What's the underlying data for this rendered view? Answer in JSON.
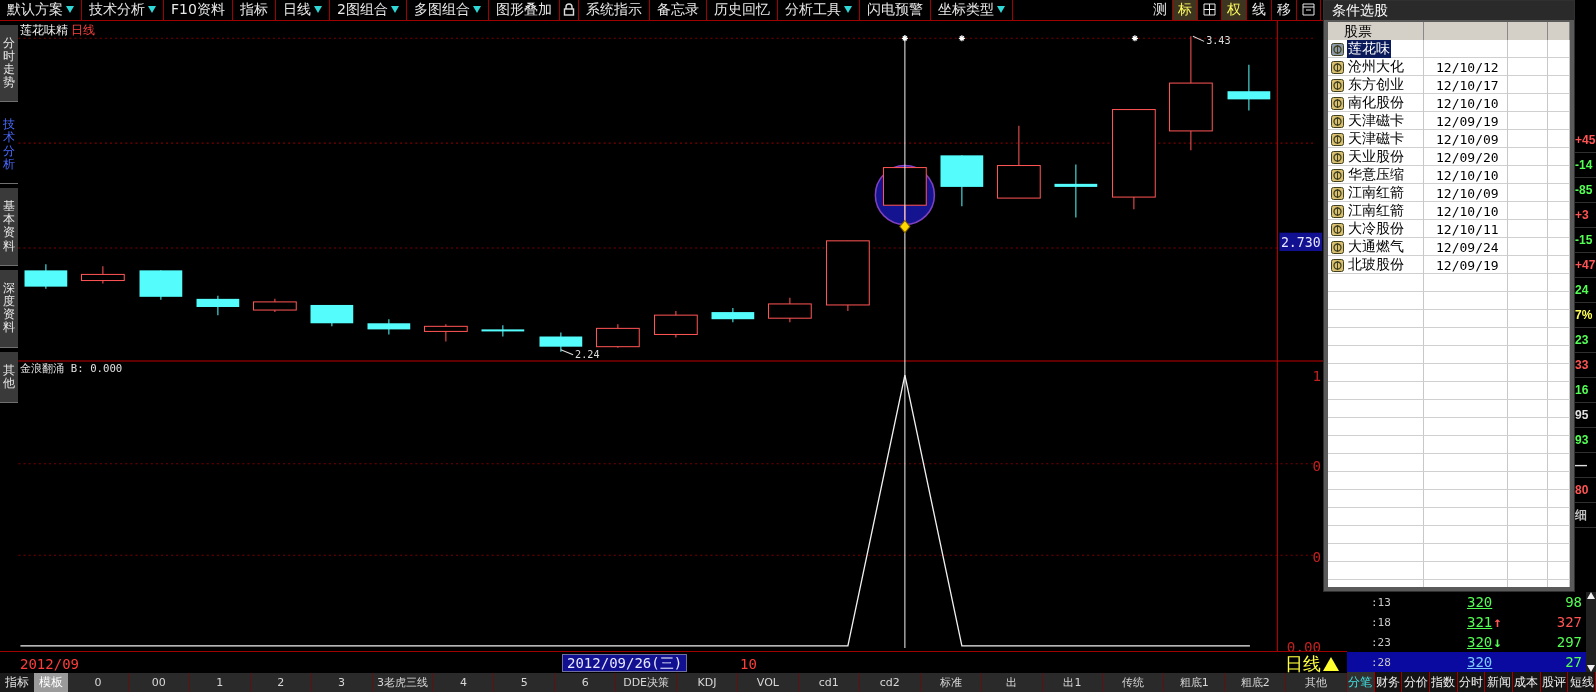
{
  "toolbar": {
    "menus": [
      {
        "kind": "menu",
        "label": "默认方案",
        "dropdown": true
      },
      {
        "kind": "menu",
        "label": "技术分析",
        "dropdown": true
      },
      {
        "kind": "menu",
        "label": "F10资料",
        "dropdown": false
      },
      {
        "kind": "menu",
        "label": "指标",
        "dropdown": false
      },
      {
        "kind": "menu",
        "label": "日线",
        "dropdown": true
      },
      {
        "kind": "menu",
        "label": "2图组合",
        "dropdown": true
      },
      {
        "kind": "menu",
        "label": "多图组合",
        "dropdown": true
      },
      {
        "kind": "menu",
        "label": "图形叠加",
        "dropdown": false
      },
      {
        "kind": "lock"
      },
      {
        "kind": "menu",
        "label": "系统指示",
        "dropdown": false
      },
      {
        "kind": "menu",
        "label": "备忘录",
        "dropdown": false
      },
      {
        "kind": "menu",
        "label": "历史回忆",
        "dropdown": false
      },
      {
        "kind": "menu",
        "label": "分析工具",
        "dropdown": true
      },
      {
        "kind": "menu",
        "label": "闪电预警",
        "dropdown": false
      },
      {
        "kind": "menu",
        "label": "坐标类型",
        "dropdown": true
      }
    ],
    "tools": [
      {
        "kind": "text",
        "label": "测",
        "on": false
      },
      {
        "kind": "text",
        "label": "标",
        "on": true
      },
      {
        "kind": "grid",
        "on": false
      },
      {
        "kind": "text",
        "label": "权",
        "on": true
      },
      {
        "kind": "text",
        "label": "线",
        "on": false
      },
      {
        "kind": "text",
        "label": "移",
        "on": false
      },
      {
        "kind": "window",
        "on": false
      }
    ]
  },
  "side_tabs": [
    {
      "label": "分时走势",
      "selected": false
    },
    {
      "label": "技术分析",
      "selected": true
    },
    {
      "label": "基本资料",
      "selected": false
    },
    {
      "label": "深度资料",
      "selected": false
    },
    {
      "label": "其他",
      "selected": false
    }
  ],
  "chart": {
    "title": "莲花味精",
    "period": "日线",
    "indicator": "金浪翻涌 B: 0.000",
    "high_label": "3.43",
    "low_label": "2.24",
    "price_label": "2.730",
    "indicator_axis": [
      "1",
      "0",
      "0",
      "0.00"
    ],
    "dates": [
      {
        "label": "2012/09",
        "selected": false
      },
      {
        "label": "2012/09/26(三)",
        "selected": true
      },
      {
        "label": "10",
        "selected": false
      }
    ],
    "period_switch": "日线"
  },
  "bottom_bar": {
    "modes": [
      {
        "label": "指标",
        "selected": false
      },
      {
        "label": "模板",
        "selected": true
      }
    ],
    "templates": [
      {
        "label": "0",
        "selected": false
      },
      {
        "label": "00",
        "selected": false
      },
      {
        "label": "1",
        "selected": false
      },
      {
        "label": "2",
        "selected": false
      },
      {
        "label": "3",
        "selected": false
      },
      {
        "label": "3老虎三线",
        "selected": false
      },
      {
        "label": "4",
        "selected": false
      },
      {
        "label": "5",
        "selected": false
      },
      {
        "label": "6",
        "selected": false
      },
      {
        "label": "DDE决策",
        "selected": false
      },
      {
        "label": "KDJ",
        "selected": false
      },
      {
        "label": "VOL",
        "selected": false
      },
      {
        "label": "cd1",
        "selected": false
      },
      {
        "label": "cd2",
        "selected": false
      },
      {
        "label": "标准",
        "selected": false
      },
      {
        "label": "出",
        "selected": false
      },
      {
        "label": "出1",
        "selected": false
      },
      {
        "label": "传统",
        "selected": false
      },
      {
        "label": "粗底1",
        "selected": false
      },
      {
        "label": "粗底2",
        "selected": false
      },
      {
        "label": "其他",
        "selected": false
      }
    ]
  },
  "right_panel": {
    "values": [
      {
        "text": "+45",
        "color": "#ff5454"
      },
      {
        "text": "-14",
        "color": "#54ff54"
      },
      {
        "text": "-85",
        "color": "#54ff54"
      },
      {
        "text": "+3",
        "color": "#ff5454"
      },
      {
        "text": "-15",
        "color": "#54ff54"
      },
      {
        "text": "+47",
        "color": "#ff5454"
      },
      {
        "text": "24",
        "color": "#54ff54"
      },
      {
        "text": "7%",
        "color": "#ffff54"
      },
      {
        "text": "23",
        "color": "#54ff54"
      },
      {
        "text": "33",
        "color": "#ff5454"
      },
      {
        "text": "16",
        "color": "#54ff54"
      },
      {
        "text": "95",
        "color": "#e0e0e0"
      },
      {
        "text": "93",
        "color": "#54ff54"
      },
      {
        "text": "—",
        "color": "#e0e0e0"
      },
      {
        "text": "80",
        "color": "#ff5454"
      },
      {
        "text": "细",
        "color": "#c0c0c0"
      }
    ],
    "ticks": [
      {
        "time": ":13",
        "price": "320",
        "volume": {
          "text": "98",
          "color": "#54ff54"
        },
        "selected": false
      },
      {
        "time": ":18",
        "price": "321",
        "arrow": {
          "text": "↑",
          "color": "#ff5454"
        },
        "volume": {
          "text": "327",
          "color": "#ff5454"
        },
        "selected": false
      },
      {
        "time": ":23",
        "price": "320",
        "arrow": {
          "text": "↓",
          "color": "#54ff54"
        },
        "volume": {
          "text": "297",
          "color": "#54ff54"
        },
        "selected": false
      },
      {
        "time": ":28",
        "price": "320",
        "volume": {
          "text": "27",
          "color": "#54ff54"
        },
        "selected": true
      }
    ],
    "tabs": [
      {
        "label": "分笔",
        "selected": true
      },
      {
        "label": "财务",
        "selected": false
      },
      {
        "label": "分价",
        "selected": false
      },
      {
        "label": "指数",
        "selected": false
      },
      {
        "label": "分时",
        "selected": false
      },
      {
        "label": "新闻",
        "selected": false
      },
      {
        "label": "成本",
        "selected": false
      },
      {
        "label": "股评",
        "selected": false
      },
      {
        "label": "短线",
        "selected": false
      }
    ]
  },
  "dialog": {
    "title": "条件选股",
    "columns": [
      "股票"
    ],
    "rows": [
      {
        "name": "莲花味",
        "selected": true
      },
      {
        "name": "沧州大化",
        "date": "12/10/12",
        "selected": false
      },
      {
        "name": "东方创业",
        "date": "12/10/17",
        "selected": false
      },
      {
        "name": "南化股份",
        "date": "12/10/10",
        "selected": false
      },
      {
        "name": "天津磁卡",
        "date": "12/09/19",
        "selected": false
      },
      {
        "name": "天津磁卡",
        "date": "12/10/09",
        "selected": false
      },
      {
        "name": "天业股份",
        "date": "12/09/20",
        "selected": false
      },
      {
        "name": "华意压缩",
        "date": "12/10/10",
        "selected": false
      },
      {
        "name": "江南红箭",
        "date": "12/10/09",
        "selected": false
      },
      {
        "name": "江南红箭",
        "date": "12/10/10",
        "selected": false
      },
      {
        "name": "大冷股份",
        "date": "12/10/11",
        "selected": false
      },
      {
        "name": "大通燃气",
        "date": "12/09/24",
        "selected": false
      },
      {
        "name": "北玻股份",
        "date": "12/09/19",
        "selected": false
      }
    ]
  }
}
